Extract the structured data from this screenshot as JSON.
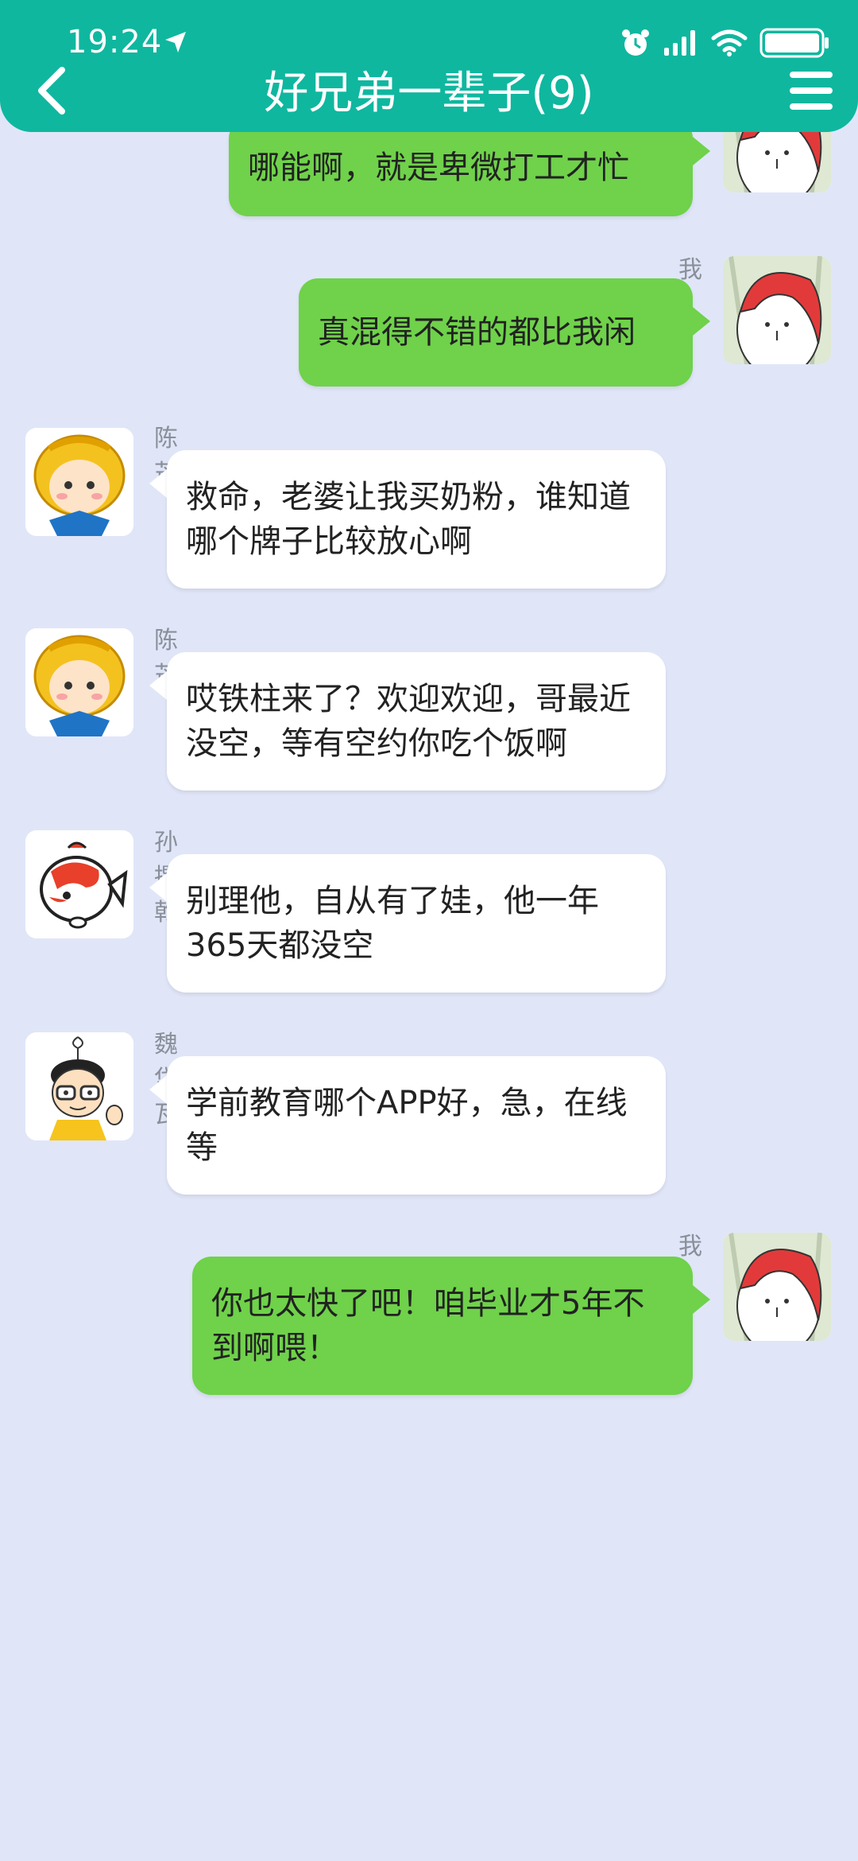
{
  "status_bar": {
    "time": "19:24",
    "icons": [
      "location-arrow-icon",
      "alarm-icon",
      "signal-icon",
      "wifi-icon",
      "battery-icon"
    ]
  },
  "header": {
    "title": "好兄弟一辈子(9)",
    "back_icon": "back-chevron-icon",
    "menu_icon": "hamburger-menu-icon",
    "color": "#0fb79f"
  },
  "colors": {
    "background": "#e0e6f8",
    "my_bubble": "#6fd24a",
    "other_bubble": "#ffffff"
  },
  "messages": [
    {
      "from": "me",
      "sender": "",
      "avatar": "red-hood-avatar",
      "text": "哪能啊，就是卑微打工才忙"
    },
    {
      "from": "me",
      "sender": "我",
      "avatar": "red-hood-avatar",
      "text": "真混得不错的都比我闲"
    },
    {
      "from": "other",
      "sender": "陈芒",
      "avatar": "monkey-king-avatar",
      "text": "救命，老婆让我买奶粉，谁知道哪个牌子比较放心啊"
    },
    {
      "from": "other",
      "sender": "陈芒",
      "avatar": "monkey-king-avatar",
      "text": "哎铁柱来了？欢迎欢迎，哥最近没空，等有空约你吃个饭啊"
    },
    {
      "from": "other",
      "sender": "孙撰乾",
      "avatar": "koi-fish-avatar",
      "text": "别理他，自从有了娃，他一年365天都没空"
    },
    {
      "from": "other",
      "sender": "魏岱瓦",
      "avatar": "glasses-boy-avatar",
      "text": "学前教育哪个APP好，急，在线等"
    },
    {
      "from": "me",
      "sender": "我",
      "avatar": "red-hood-avatar",
      "text": "你也太快了吧！咱毕业才5年不到啊喂！"
    }
  ]
}
